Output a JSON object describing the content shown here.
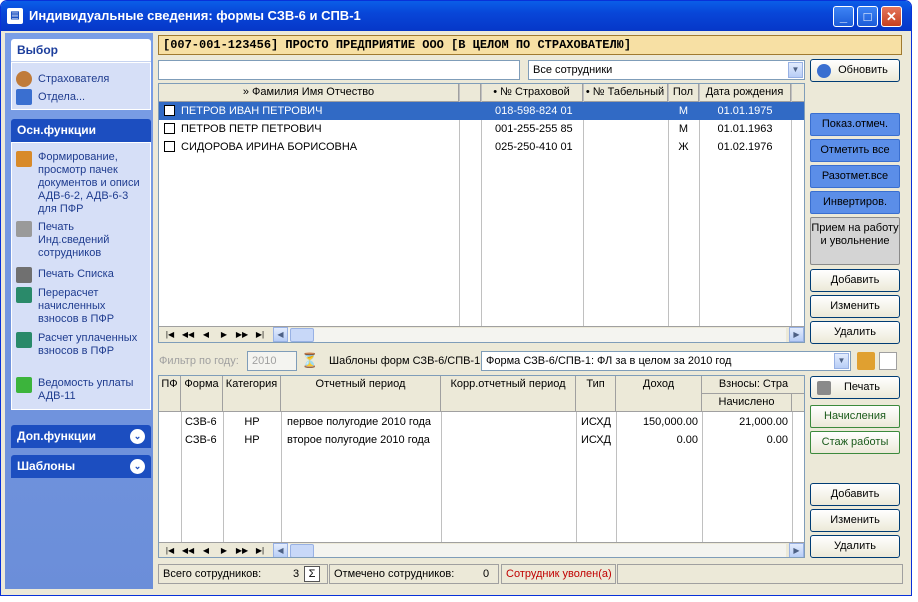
{
  "window": {
    "title": "Индивидуальные сведения: формы СЗВ-6 и СПВ-1",
    "app_icon": "document-app-icon"
  },
  "sidebar": {
    "select_group": {
      "title": "Выбор",
      "items": [
        {
          "label": "Страхователя",
          "icon": "users-icon"
        },
        {
          "label": "Отдела...",
          "icon": "org-structure-icon"
        }
      ]
    },
    "main_group": {
      "title": "Осн.функции",
      "items": [
        {
          "label": "Формирование, просмотр пачек документов и описи АДВ-6-2, АДВ-6-3 для ПФР",
          "icon": "documents-icon"
        },
        {
          "label": "Печать Инд.сведений сотрудников",
          "icon": "printer-icon"
        },
        {
          "label": "Печать Списка",
          "icon": "printer-list-icon"
        },
        {
          "label": "Перерасчет начисленных взносов в ПФР",
          "icon": "calculator-icon"
        },
        {
          "label": "Расчет уплаченных взносов в ПФР",
          "icon": "calculator-icon"
        },
        {
          "label": "Ведомость уплаты АДВ-11",
          "icon": "green-document-icon"
        }
      ]
    },
    "extra_group": {
      "title": "Доп.функции"
    },
    "templates_group": {
      "title": "Шаблоны"
    }
  },
  "header": {
    "company": "[007-001-123456] ПРОСТО ПРЕДПРИЯТИЕ ООО [В ЦЕЛОМ ПО СТРАХОВАТЕЛЮ]"
  },
  "filter": {
    "search_value": "",
    "employees_select": "Все сотрудники",
    "refresh": "Обновить"
  },
  "employees": {
    "columns": [
      "» Фамилия Имя Отчество",
      "• № Страховой",
      "• № Табельный",
      "Пол",
      "Дата рождения"
    ],
    "rows": [
      {
        "name": "ПЕТРОВ ИВАН ПЕТРОВИЧ",
        "snils": "018-598-824 01",
        "tab": "",
        "sex": "М",
        "dob": "01.01.1975",
        "selected": true
      },
      {
        "name": "ПЕТРОВ ПЕТР ПЕТРОВИЧ",
        "snils": "001-255-255 85",
        "tab": "",
        "sex": "М",
        "dob": "01.01.1963",
        "selected": false
      },
      {
        "name": "СИДОРОВА ИРИНА БОРИСОВНА",
        "snils": "025-250-410 01",
        "tab": "",
        "sex": "Ж",
        "dob": "01.02.1976",
        "selected": false
      }
    ]
  },
  "right_buttons": {
    "show_marked": "Показ.отмеч.",
    "mark_all": "Отметить все",
    "unmark_all": "Разотмет.все",
    "invert": "Инвертиров.",
    "hire": "Прием на работу и увольнение",
    "add": "Добавить",
    "edit": "Изменить",
    "delete": "Удалить"
  },
  "forms_bar": {
    "year_label": "Фильтр по году:",
    "year_value": "2010",
    "templates_label": "Шаблоны форм СЗВ-6/СПВ-1:",
    "template_value": "Форма СЗВ-6/СПВ-1: ФЛ за в целом за 2010 год"
  },
  "forms": {
    "columns": [
      "ПФ",
      "Форма",
      "Категория",
      "Отчетный период",
      "Корр.отчетный период",
      "Тип",
      "Доход",
      "Взносы: Стра"
    ],
    "subcolumn": "Начислено",
    "rows": [
      {
        "pf": "",
        "form": "СЗВ-6",
        "cat": "НР",
        "period": "первое полугодие 2010 года",
        "corr": "",
        "type": "ИСХД",
        "income": "150,000.00",
        "accrued": "21,000.00"
      },
      {
        "pf": "",
        "form": "СЗВ-6",
        "cat": "НР",
        "period": "второе полугодие 2010 года",
        "corr": "",
        "type": "ИСХД",
        "income": "0.00",
        "accrued": "0.00"
      }
    ]
  },
  "form_buttons": {
    "print": "Печать",
    "accruals": "Начисления",
    "seniority": "Стаж работы",
    "add": "Добавить",
    "edit": "Изменить",
    "delete": "Удалить"
  },
  "status": {
    "total_label": "Всего сотрудников:",
    "total_value": "3",
    "marked_label": "Отмечено сотрудников:",
    "marked_value": "0",
    "dismissed": "Сотрудник уволен(а)"
  },
  "colors": {
    "accent": "#1c4ec0",
    "selected_row": "#316ac5",
    "dismissed_text": "#c00000"
  }
}
